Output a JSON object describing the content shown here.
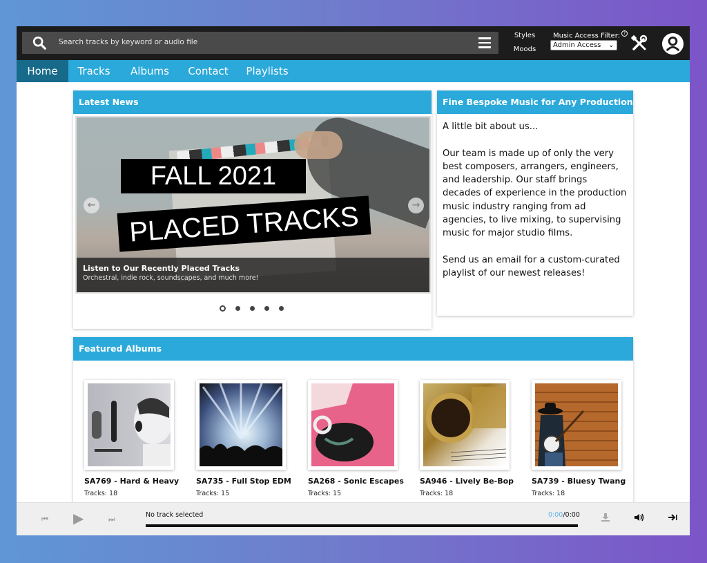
{
  "topbar": {
    "search_placeholder": "Search tracks by keyword or audio file",
    "styles_label": "Styles",
    "moods_label": "Moods",
    "access_filter_label": "Music Access Filter:",
    "access_filter_help": "?",
    "access_filter_value": "Admin Access",
    "icons": [
      "search-icon",
      "menu-icon",
      "help-icon",
      "tools-icon",
      "user-avatar-icon"
    ]
  },
  "nav": {
    "items": [
      {
        "label": "Home",
        "active": true
      },
      {
        "label": "Tracks",
        "active": false
      },
      {
        "label": "Albums",
        "active": false
      },
      {
        "label": "Contact",
        "active": false
      },
      {
        "label": "Playlists",
        "active": false
      }
    ]
  },
  "news": {
    "header": "Latest News",
    "slide": {
      "banner_line1": "FALL 2021",
      "banner_line2": "PLACED TRACKS",
      "caption_title": "Listen to Our Recently Placed Tracks",
      "caption_subtitle": "Orchestral, indie rock, soundscapes, and much more!"
    },
    "prev_arrow": "←",
    "next_arrow": "→",
    "slide_count": 5,
    "active_slide": 1
  },
  "about": {
    "header": "Fine Bespoke Music for Any Production",
    "body": "A little bit about us...\n\nOur team is made up of only the very best composers, arrangers, engineers, and leadership. Our staff brings decades of experience in the production music industry ranging from ad agencies, to live mixing, to supervising music for major studio films.\n\nSend us an email for a custom-curated playlist of our newest releases!"
  },
  "featured": {
    "header": "Featured Albums",
    "albums": [
      {
        "title": "SA769 - Hard & Heavy",
        "tracks": "Tracks: 18"
      },
      {
        "title": "SA735 - Full Stop EDM",
        "tracks": "Tracks: 15"
      },
      {
        "title": "SA268 - Sonic Escapes",
        "tracks": "Tracks: 15"
      },
      {
        "title": "SA946 - Lively Be-Bop",
        "tracks": "Tracks: 18"
      },
      {
        "title": "SA739 - Bluesy Twang",
        "tracks": "Tracks: 18"
      }
    ]
  },
  "player": {
    "track_name": "No track selected",
    "current_time": "0:00",
    "total_time": "/0:00",
    "progress": 0,
    "colors": {
      "current_time": "#5fb6e6"
    }
  },
  "colors": {
    "accent": "#2aa9da",
    "nav_active": "#176a8a",
    "topbar": "#1c1c1c"
  }
}
